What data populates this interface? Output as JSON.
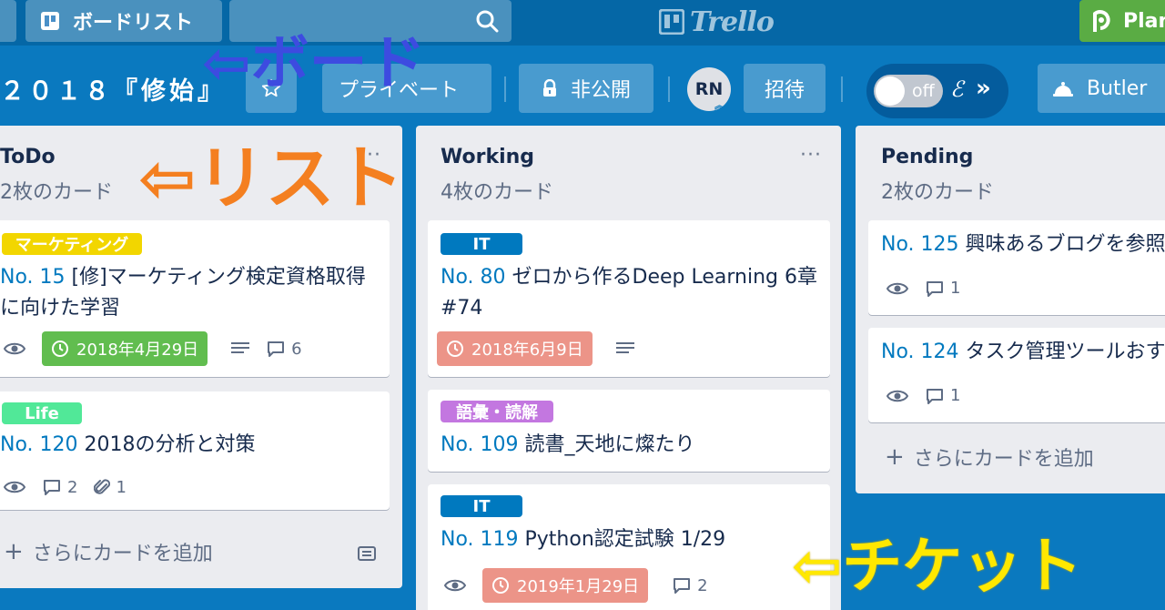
{
  "topbar": {
    "boards_label": "ボードリスト",
    "logo_text": "Trello",
    "plan_label": "Plan"
  },
  "board": {
    "title": "２０１８『修始』",
    "private_label": "プライベート",
    "visibility_label": "非公開",
    "avatar_initials": "RN",
    "invite_label": "招待",
    "toggle_label": "off",
    "butler_label": "Butler"
  },
  "lists": [
    {
      "title": "ToDo",
      "count": "2枚のカード",
      "add_card": "さらにカードを追加",
      "cards": [
        {
          "label": "マーケティング",
          "number": "No. 15",
          "title": "[修]マーケティング検定資格取得に向けた学習",
          "due": "2018年4月29日",
          "comments": "6"
        },
        {
          "label": "Life",
          "number": "No. 120",
          "title": "2018の分析と対策",
          "comments": "2",
          "attachments": "1"
        }
      ]
    },
    {
      "title": "Working",
      "count": "4枚のカード",
      "cards": [
        {
          "label": "IT",
          "number": "No. 80",
          "title": "ゼロから作るDeep Learning 6章 #74",
          "due": "2018年6月9日"
        },
        {
          "label": "語彙・読解",
          "number": "No. 109",
          "title": "読書_天地に燦たり"
        },
        {
          "label": "IT",
          "number": "No. 119",
          "title": "Python認定試験 1/29",
          "due": "2019年1月29日",
          "comments": "2"
        }
      ]
    },
    {
      "title": "Pending",
      "count": "2枚のカード",
      "add_card": "さらにカードを追加",
      "cards": [
        {
          "number": "No. 125",
          "title": "興味あるブログを参照",
          "comments": "1"
        },
        {
          "number": "No. 124",
          "title": "タスク管理ツールおすすめ",
          "comments": "1"
        }
      ]
    }
  ],
  "annotations": {
    "board": "⇦ボード",
    "list": "⇦リスト",
    "ticket": "⇦チケット"
  },
  "colors": {
    "board_bg": "#0a79bf",
    "nav_bg": "#0567a6",
    "plan_green": "#5aac44",
    "link_blue": "#0079bf",
    "due_green": "#61bd4f",
    "due_red": "#ec9488",
    "label_yellow": "#f2d600",
    "label_green": "#51e898",
    "label_blue": "#0079bf",
    "label_purple": "#c377e0"
  }
}
